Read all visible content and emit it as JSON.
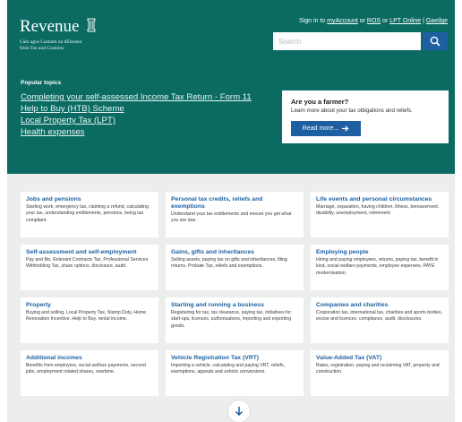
{
  "header": {
    "logo_text": "Revenue",
    "logo_subtitle_line1": "Cáin agus Custaim na hÉireann",
    "logo_subtitle_line2": "Irish Tax and Customs",
    "toplinks": {
      "sign_in_text": "Sign in to",
      "my_account": "myAccount",
      "or1": "or",
      "ros": "ROS",
      "or2": "or",
      "lpt_online": "LPT Online",
      "separator": "|",
      "gaeilge": "Gaeilge"
    },
    "search": {
      "placeholder": "Search",
      "icon": "search-icon"
    }
  },
  "popular": {
    "title": "Popular topics",
    "links": [
      "Completing your self-assessed Income Tax Return - Form 11",
      "Help to Buy (HTB) Scheme",
      "Local Property Tax (LPT)",
      "Health expenses"
    ]
  },
  "farmer": {
    "title": "Are you a farmer?",
    "description": "Learn more about your tax obligations and reliefs.",
    "button_label": "Read more...",
    "button_icon": "arrow-right-icon"
  },
  "cards": [
    {
      "title": "Jobs and pensions",
      "description": "Starting work, emergency tax, claiming a refund, calculating your tax, understanding entitlements, pensions, being tax compliant."
    },
    {
      "title": "Personal tax credits, reliefs and exemptions",
      "description": "Understand your tax entitlements and ensure you get what you are due."
    },
    {
      "title": "Life events and personal circumstances",
      "description": "Marriage, separation, having children, illness, bereavement, disability, unemployment, retirement."
    },
    {
      "title": "Self-assessment and self-employment",
      "description": "Pay and file, Relevant Contracts Tax, Professional Services Withholding Tax, share options, disclosure, audit."
    },
    {
      "title": "Gains, gifts and inheritances",
      "description": "Selling assets, paying tax on gifts and inheritances, filing returns, Probate Tax, reliefs and exemptions."
    },
    {
      "title": "Employing people",
      "description": "Hiring and paying employees, returns, paying tax, benefit in kind, social welfare payments, employee expenses, PAYE modernisation."
    },
    {
      "title": "Property",
      "description": "Buying and selling, Local Property Tax, Stamp Duty, Home Renovation Incentive, Help to Buy, rental income."
    },
    {
      "title": "Starting and running a business",
      "description": "Registering for tax, tax clearance, paying tax, initiatives for start-ups, licences, authorisations, importing and exporting goods."
    },
    {
      "title": "Companies and charities",
      "description": "Corporation tax, international tax, charities and sports bodies, excise and licences, compliance, audit, disclosures."
    },
    {
      "title": "Additional incomes",
      "description": "Benefits from employers, social welfare payments, second jobs, employment related shares, overtime."
    },
    {
      "title": "Vehicle Registration Tax (VRT)",
      "description": "Importing a vehicle, calculating and paying VRT, reliefs, exemptions, appeals and vehicle conversions."
    },
    {
      "title": "Value-Added Tax (VAT)",
      "description": "Rates, registration, paying and reclaiming VAT, property and construction."
    }
  ],
  "scroll_button": {
    "icon": "arrow-down-icon"
  },
  "colors": {
    "header_bg": "#0b6b63",
    "accent_blue": "#1d5fa0",
    "page_bg": "#eceeee"
  }
}
